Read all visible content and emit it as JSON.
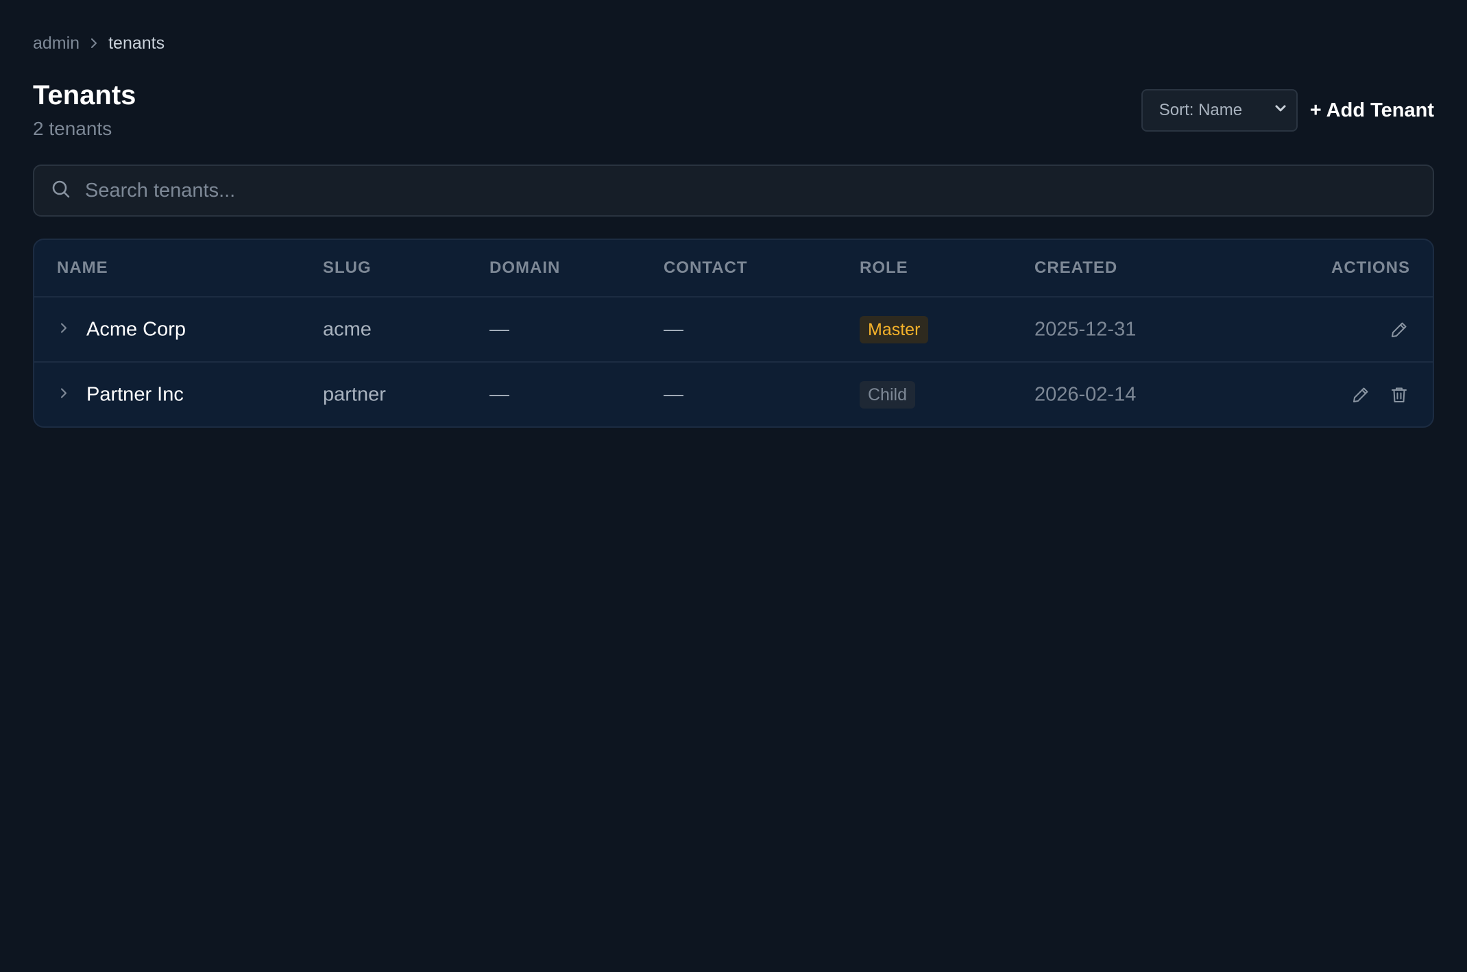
{
  "breadcrumb": {
    "root": "admin",
    "current": "tenants"
  },
  "header": {
    "title": "Tenants",
    "subtitle": "2 tenants",
    "sort_label": "Sort: Name",
    "add_label": "+ Add Tenant"
  },
  "search": {
    "placeholder": "Search tenants...",
    "value": ""
  },
  "table": {
    "columns": [
      "NAME",
      "SLUG",
      "DOMAIN",
      "CONTACT",
      "ROLE",
      "CREATED",
      "ACTIONS"
    ],
    "rows": [
      {
        "name": "Acme Corp",
        "slug": "acme",
        "domain": "—",
        "contact": "—",
        "role": "Master",
        "created": "2025-12-31",
        "actions": [
          "edit-icon"
        ]
      },
      {
        "name": "Partner Inc",
        "slug": "partner",
        "domain": "—",
        "contact": "—",
        "role": "Child",
        "created": "2026-02-14",
        "actions": [
          "edit-icon",
          "trash-icon"
        ]
      }
    ]
  },
  "colors": {
    "background": "#0d1520",
    "table_background": "#0e1e33",
    "master_badge_text": "#f5b22a",
    "child_badge_text": "#7d8896"
  }
}
